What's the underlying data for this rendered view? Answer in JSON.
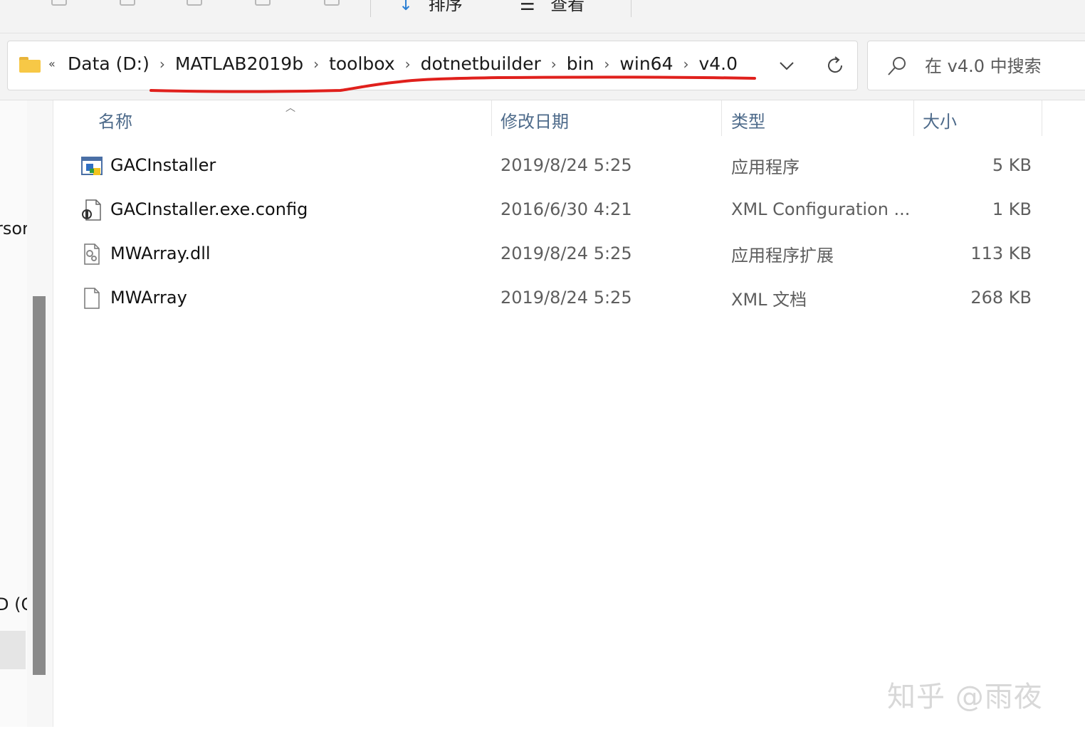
{
  "toolbar": {
    "sort_label": "排序",
    "view_label": "查看"
  },
  "address_bar": {
    "overflow": "«",
    "crumbs": [
      "Data (D:)",
      "MATLAB2019b",
      "toolbox",
      "dotnetbuilder",
      "bin",
      "win64",
      "v4.0"
    ],
    "separator": "›"
  },
  "search": {
    "placeholder": "在 v4.0 中搜索"
  },
  "nav_pane": {
    "partial_item_1": "rsor",
    "partial_item_2": "D (C"
  },
  "columns": {
    "name": "名称",
    "date": "修改日期",
    "type": "类型",
    "size": "大小"
  },
  "files": [
    {
      "name": "GACInstaller",
      "date": "2019/8/24 5:25",
      "type": "应用程序",
      "size": "5 KB",
      "icon": "application-icon"
    },
    {
      "name": "GACInstaller.exe.config",
      "date": "2016/6/30 4:21",
      "type": "XML Configuration ...",
      "size": "1 KB",
      "icon": "config-file-icon"
    },
    {
      "name": "MWArray.dll",
      "date": "2019/8/24 5:25",
      "type": "应用程序扩展",
      "size": "113 KB",
      "icon": "dll-file-icon"
    },
    {
      "name": "MWArray",
      "date": "2019/8/24 5:25",
      "type": "XML 文档",
      "size": "268 KB",
      "icon": "document-file-icon"
    }
  ],
  "colors": {
    "annotation_red": "#e0201c",
    "header_text": "#4d6a8a",
    "folder_yellow": "#f7c846"
  },
  "watermark": "知乎 @雨夜"
}
